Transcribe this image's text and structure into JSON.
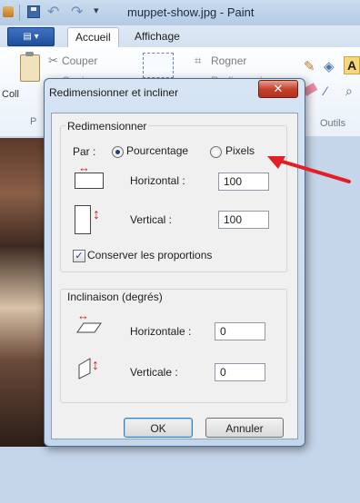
{
  "window": {
    "title": "muppet-show.jpg - Paint",
    "tabs": [
      "Accueil",
      "Affichage"
    ],
    "app_menu_label": "▤ ▾"
  },
  "ribbon": {
    "couper": "Couper",
    "copier": "Copier",
    "coller_partial": "Coll",
    "p_partial": "P",
    "rogner": "Rogner",
    "redimensionner_partial": "Redimensionner",
    "outils": "Outils",
    "text_tool": "A"
  },
  "dialog": {
    "title": "Redimensionner et incliner",
    "close": "✕",
    "resize": {
      "legend": "Redimensionner",
      "par_label": "Par :",
      "option_percent": "Pourcentage",
      "option_pixels": "Pixels",
      "selected": "Pourcentage",
      "horizontal_label": "Horizontal :",
      "horizontal_value": "100",
      "vertical_label": "Vertical :",
      "vertical_value": "100",
      "keep_ratio_label": "Conserver les proportions",
      "keep_ratio_checked": true
    },
    "skew": {
      "legend": "Inclinaison (degrés)",
      "horizontal_label": "Horizontale :",
      "horizontal_value": "0",
      "vertical_label": "Verticale :",
      "vertical_value": "0"
    },
    "ok_label": "OK",
    "cancel_label": "Annuler"
  },
  "annotation": {
    "arrow_color": "#e31e24"
  }
}
